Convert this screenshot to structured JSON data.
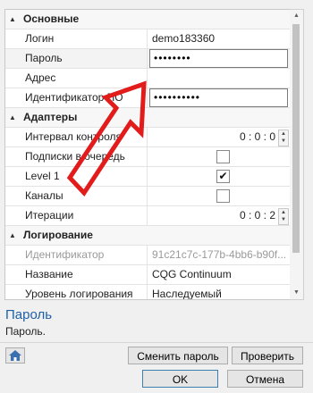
{
  "grid": {
    "cat_main": "Основные",
    "login_name": "Логин",
    "login_value": "demo183360",
    "password_name": "Пароль",
    "password_value": "••••••••",
    "address_name": "Адрес",
    "address_value": "",
    "id_po_name": "Идентификатор ПО",
    "id_po_value": "••••••••••",
    "cat_adapters": "Адаптеры",
    "interval_name": "Интервал контроля",
    "interval_value": "0 : 0 : 0",
    "subs_name": "Подписки в очередь",
    "level1_name": "Level 1",
    "channels_name": "Каналы",
    "iter_name": "Итерации",
    "iter_value": "0 : 0 : 2",
    "cat_logging": "Логирование",
    "identifier_name": "Идентификатор",
    "identifier_value": "91c21c7c-177b-4bb6-b90f...",
    "title_name": "Название",
    "title_value": "CQG Continuum",
    "loglevel_name": "Уровень логирования",
    "loglevel_value": "Наследуемый",
    "subs_checked": false,
    "level1_checked": true,
    "channels_checked": false
  },
  "description": {
    "title": "Пароль",
    "text": "Пароль."
  },
  "buttons": {
    "change_password": "Сменить пароль",
    "check": "Проверить",
    "ok": "OK",
    "cancel": "Отмена"
  },
  "icons": {
    "expand": "▲",
    "check": "✔",
    "spin_up": "▲",
    "spin_down": "▼"
  },
  "colors": {
    "arrow": "#e21b1b",
    "desc_title": "#1f5fa8"
  }
}
